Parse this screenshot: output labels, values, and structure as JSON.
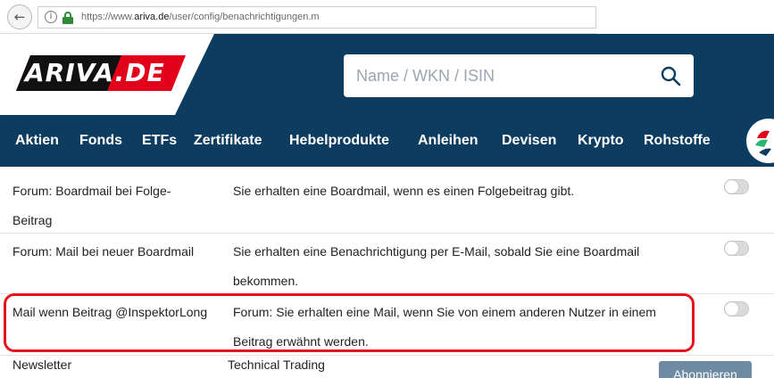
{
  "browser": {
    "url_prefix": "https://www.",
    "url_host": "ariva.de",
    "url_path": "/user/config/benachrichtigungen.m"
  },
  "header": {
    "logo_text": "ARIVA.DE",
    "search_placeholder": "Name / WKN / ISIN",
    "brand_color": "#0d3c61",
    "logo_color": "#e3001b"
  },
  "nav": {
    "items": [
      "Aktien",
      "Fonds",
      "ETFs",
      "Zertifikate",
      "Hebelprodukte",
      "Anleihen",
      "Devisen",
      "Krypto",
      "Rohstoffe"
    ]
  },
  "settings": {
    "rows": [
      {
        "label_line1": "Forum: Boardmail bei Folge-",
        "label_line2": "Beitrag",
        "desc_line1": "Sie erhalten eine Boardmail, wenn es einen Folgebeitrag gibt.",
        "desc_line2": "",
        "enabled": false
      },
      {
        "label_line1": "Forum: Mail bei neuer Boardmail",
        "label_line2": "",
        "desc_line1": "Sie erhalten eine Benachrichtigung per E-Mail, sobald Sie eine Boardmail",
        "desc_line2": "bekommen.",
        "enabled": false
      },
      {
        "label_line1": "Mail wenn Beitrag @InspektorLong",
        "label_line2": "",
        "desc_line1": "Forum: Sie erhalten eine Mail, wenn Sie von einem anderen Nutzer in einem",
        "desc_line2": "Beitrag erwähnt werden.",
        "enabled": false
      }
    ],
    "newsletter": {
      "label": "Newsletter",
      "desc": "Technical Trading",
      "button": "Abonnieren"
    },
    "highlight_color": "#e8141b"
  }
}
